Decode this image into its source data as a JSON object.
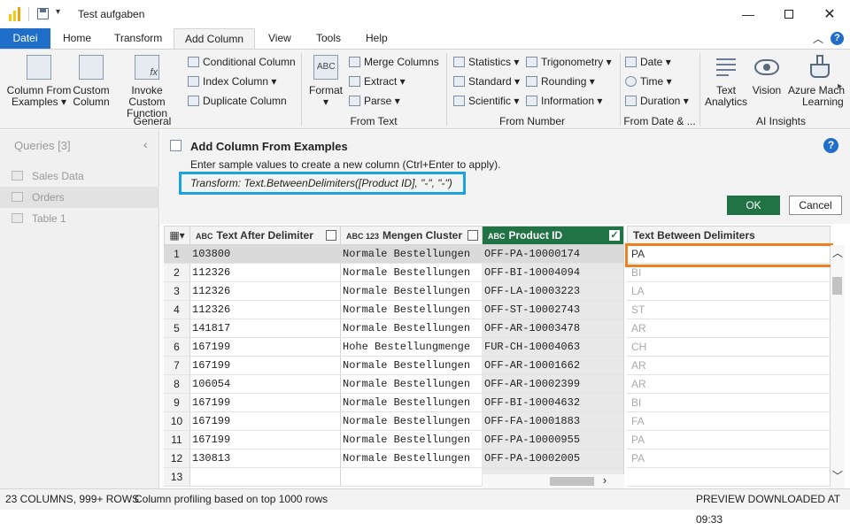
{
  "window": {
    "title": "Test aufgaben"
  },
  "tabs": [
    "Datei",
    "Home",
    "Transform",
    "Add Column",
    "View",
    "Tools",
    "Help"
  ],
  "ribbon": {
    "general": {
      "label": "General",
      "column_from_examples": [
        "Column From",
        "Examples"
      ],
      "custom_column": [
        "Custom",
        "Column"
      ],
      "invoke_custom_function": [
        "Invoke Custom",
        "Function"
      ],
      "conditional_column": "Conditional Column",
      "index_column": "Index Column",
      "duplicate_column": "Duplicate Column"
    },
    "from_text": {
      "label": "From Text",
      "format": "Format",
      "merge_columns": "Merge Columns",
      "extract": "Extract",
      "parse": "Parse"
    },
    "from_number": {
      "label": "From Number",
      "statistics": "Statistics",
      "standard": "Standard",
      "scientific": "Scientific",
      "trigonometry": "Trigonometry",
      "rounding": "Rounding",
      "information": "Information"
    },
    "from_date": {
      "label": "From Date & ...",
      "date": "Date",
      "time": "Time",
      "duration": "Duration"
    },
    "ai": {
      "label": "AI Insights",
      "text_analytics": [
        "Text",
        "Analytics"
      ],
      "vision": "Vision",
      "azure_ml": [
        "Azure Mach",
        "Learning"
      ]
    }
  },
  "queries": {
    "header": "Queries [3]",
    "items": [
      "Sales Data",
      "Orders",
      "Table 1"
    ]
  },
  "examples_pane": {
    "title": "Add Column From Examples",
    "instructions": "Enter sample values to create a new column (Ctrl+Enter to apply).",
    "transform": "Transform: Text.BetweenDelimiters([Product ID], \"-\", \"-\")",
    "ok": "OK",
    "cancel": "Cancel"
  },
  "grid": {
    "columns": [
      {
        "type": "ABC",
        "name": "Text After Delimiter"
      },
      {
        "type": "ABC 123",
        "name": "Mengen Cluster"
      },
      {
        "type": "ABC",
        "name": "Product ID"
      },
      {
        "type": "",
        "name": "Text Between Delimiters"
      }
    ],
    "rows": [
      {
        "n": "1",
        "a": "103800",
        "b": "Normale Bestellungen",
        "c": "OFF-PA-10000174",
        "d": "PA"
      },
      {
        "n": "2",
        "a": "112326",
        "b": "Normale Bestellungen",
        "c": "OFF-BI-10004094",
        "d": "BI"
      },
      {
        "n": "3",
        "a": "112326",
        "b": "Normale Bestellungen",
        "c": "OFF-LA-10003223",
        "d": "LA"
      },
      {
        "n": "4",
        "a": "112326",
        "b": "Normale Bestellungen",
        "c": "OFF-ST-10002743",
        "d": "ST"
      },
      {
        "n": "5",
        "a": "141817",
        "b": "Normale Bestellungen",
        "c": "OFF-AR-10003478",
        "d": "AR"
      },
      {
        "n": "6",
        "a": "167199",
        "b": "Hohe Bestellungmenge",
        "c": "FUR-CH-10004063",
        "d": "CH"
      },
      {
        "n": "7",
        "a": "167199",
        "b": "Normale Bestellungen",
        "c": "OFF-AR-10001662",
        "d": "AR"
      },
      {
        "n": "8",
        "a": "106054",
        "b": "Normale Bestellungen",
        "c": "OFF-AR-10002399",
        "d": "AR"
      },
      {
        "n": "9",
        "a": "167199",
        "b": "Normale Bestellungen",
        "c": "OFF-BI-10004632",
        "d": "BI"
      },
      {
        "n": "10",
        "a": "167199",
        "b": "Normale Bestellungen",
        "c": "OFF-FA-10001883",
        "d": "FA"
      },
      {
        "n": "11",
        "a": "167199",
        "b": "Normale Bestellungen",
        "c": "OFF-PA-10000955",
        "d": "PA"
      },
      {
        "n": "12",
        "a": "130813",
        "b": "Normale Bestellungen",
        "c": "OFF-PA-10002005",
        "d": "PA"
      },
      {
        "n": "13",
        "a": "",
        "b": "",
        "c": "",
        "d": ""
      }
    ]
  },
  "status": {
    "columns_rows": "23 COLUMNS, 999+ ROWS",
    "profiling": "Column profiling based on top 1000 rows",
    "preview": "PREVIEW DOWNLOADED AT 09:33"
  },
  "colors": {
    "accent_blue": "#1f6ec9",
    "product_id_header": "#217346",
    "ok_button": "#217346",
    "highlight_blue": "#1aa3e0",
    "highlight_orange": "#f07f22"
  }
}
